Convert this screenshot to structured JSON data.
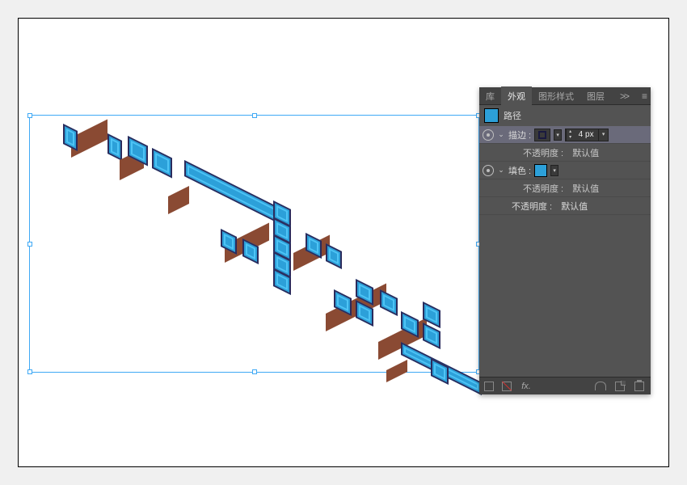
{
  "panel": {
    "tabs": {
      "library": "库",
      "appearance": "外观",
      "graphicStyles": "图形样式",
      "layers": "图层"
    },
    "expand": ">>",
    "objectType": "路径",
    "stroke": {
      "label": "描边 :",
      "weightValue": "4 px",
      "opacityLabel": "不透明度 :",
      "opacityValue": "默认值"
    },
    "fill": {
      "label": "填色 :",
      "opacityLabel": "不透明度 :",
      "opacityValue": "默认值"
    },
    "opacity": {
      "label": "不透明度 :",
      "value": "默认值"
    },
    "footer": {
      "fx": "fx."
    }
  }
}
